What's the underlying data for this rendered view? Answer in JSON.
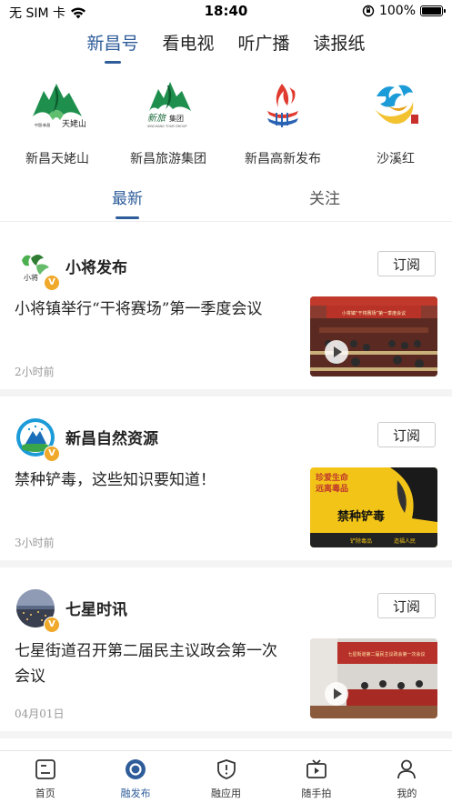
{
  "status_bar": {
    "carrier": "无 SIM 卡",
    "time": "18:40",
    "battery": "100%",
    "battery_level": 1.0
  },
  "top_tabs": [
    {
      "label": "新昌号",
      "active": true
    },
    {
      "label": "看电视",
      "active": false
    },
    {
      "label": "听广播",
      "active": false
    },
    {
      "label": "读报纸",
      "active": false
    }
  ],
  "channels": [
    {
      "name": "新昌天姥山",
      "icon": "tianmu-mountain-logo"
    },
    {
      "name": "新昌旅游集团",
      "icon": "tourism-group-logo"
    },
    {
      "name": "新昌高新发布",
      "icon": "hightech-release-logo"
    },
    {
      "name": "沙溪红",
      "icon": "shaxi-red-logo"
    }
  ],
  "feed_tabs": [
    {
      "label": "最新",
      "active": true
    },
    {
      "label": "关注",
      "active": false
    }
  ],
  "cards": [
    {
      "source": "小将发布",
      "subscribe": "订阅",
      "title": "小将镇举行“干将赛场”第一季度会议",
      "time": "2小时前",
      "verified": "V",
      "thumb_overlay": "小将镇“干将赛场”第一季度会议"
    },
    {
      "source": "新昌自然资源",
      "subscribe": "订阅",
      "title": "禁种铲毒，这些知识要知道！",
      "time": "3小时前",
      "verified": "V",
      "thumb_text": {
        "line1": "珍爱生命",
        "line2": "远离毒品",
        "main": "禁种铲毒",
        "foot1": "铲除毒品",
        "foot2": "造福人民"
      }
    },
    {
      "source": "七星时讯",
      "subscribe": "订阅",
      "title": "七星街道召开第二届民主议政会第一次会议",
      "time": "04月01日",
      "verified": "V",
      "thumb_overlay": "七星街道第二届民主议政会第一次会议"
    }
  ],
  "bottom_nav": [
    {
      "label": "首页",
      "icon": "home-icon",
      "active": false
    },
    {
      "label": "融发布",
      "icon": "publish-icon",
      "active": true
    },
    {
      "label": "融应用",
      "icon": "apps-icon",
      "active": false
    },
    {
      "label": "随手拍",
      "icon": "tv-camera-icon",
      "active": false
    },
    {
      "label": "我的",
      "icon": "profile-icon",
      "active": false
    }
  ],
  "colors": {
    "accent": "#2f5d9a",
    "badge": "#f0a92a"
  }
}
